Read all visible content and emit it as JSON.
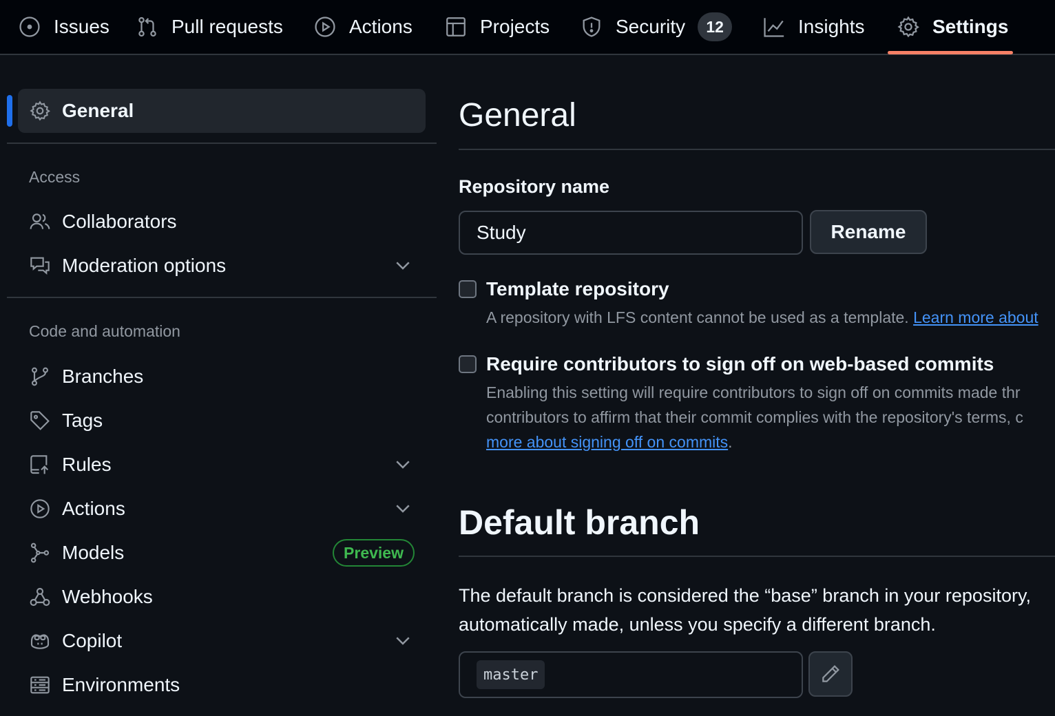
{
  "nav": {
    "tabs": [
      {
        "label": "Issues",
        "icon": "issue-opened-icon"
      },
      {
        "label": "Pull requests",
        "icon": "git-pull-request-icon"
      },
      {
        "label": "Actions",
        "icon": "play-icon"
      },
      {
        "label": "Projects",
        "icon": "table-icon"
      },
      {
        "label": "Security",
        "icon": "shield-icon",
        "counter": "12"
      },
      {
        "label": "Insights",
        "icon": "graph-icon"
      },
      {
        "label": "Settings",
        "icon": "gear-icon",
        "active": true
      }
    ],
    "active_color": "#f78166"
  },
  "sidebar": {
    "general": "General",
    "access_heading": "Access",
    "collaborators": "Collaborators",
    "moderation": "Moderation options",
    "code_heading": "Code and automation",
    "branches": "Branches",
    "tags": "Tags",
    "rules": "Rules",
    "actions": "Actions",
    "models": "Models",
    "models_badge": "Preview",
    "webhooks": "Webhooks",
    "copilot": "Copilot",
    "environments": "Environments",
    "accent": "#1f6feb"
  },
  "main": {
    "title": "General",
    "repo_name_label": "Repository name",
    "repo_name_value": "Study",
    "rename_button": "Rename",
    "template": {
      "label": "Template repository",
      "note": "A repository with LFS content cannot be used as a template.",
      "link": "Learn more about"
    },
    "signoff": {
      "label": "Require contributors to sign off on web-based commits",
      "note_line1": "Enabling this setting will require contributors to sign off on commits made thr",
      "note_line2": "contributors to affirm that their commit complies with the repository's terms, c",
      "link": "more about signing off on commits",
      "after_link": "."
    },
    "default_branch": {
      "title": "Default branch",
      "line1": "The default branch is considered the “base” branch in your repository,",
      "line2": "automatically made, unless you specify a different branch.",
      "branch": "master"
    }
  }
}
